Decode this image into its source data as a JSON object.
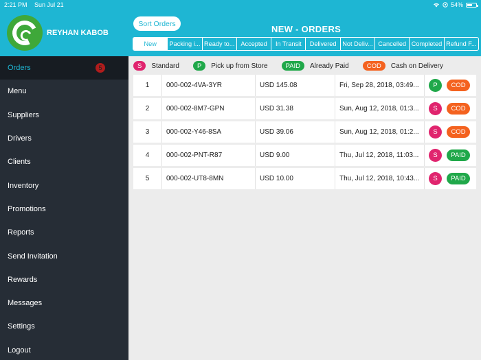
{
  "status_bar": {
    "time": "2:21 PM",
    "date": "Sun Jul 21",
    "battery": "54%"
  },
  "brand": {
    "name": "REYHAN KABOB"
  },
  "sidebar": {
    "items": [
      {
        "label": "Orders",
        "badge": "5"
      },
      {
        "label": "Menu"
      },
      {
        "label": "Suppliers"
      },
      {
        "label": "Drivers"
      },
      {
        "label": "Clients"
      },
      {
        "label": "Inventory"
      },
      {
        "label": "Promotions"
      },
      {
        "label": "Reports"
      },
      {
        "label": "Send Invitation"
      },
      {
        "label": "Rewards"
      },
      {
        "label": "Messages"
      },
      {
        "label": "Settings"
      },
      {
        "label": "Logout"
      }
    ]
  },
  "header": {
    "sort_label": "Sort Orders",
    "title": "NEW - ORDERS",
    "tabs": [
      "New",
      "Packing i...",
      "Ready to...",
      "Accepted",
      "In Transit",
      "Delivered",
      "Not Deliv...",
      "Cancelled",
      "Completed",
      "Refund F..."
    ]
  },
  "legend": {
    "standard_tag": "S",
    "standard_label": "Standard",
    "pickup_tag": "P",
    "pickup_label": "Pick up from Store",
    "paid_tag": "PAID",
    "paid_label": "Already Paid",
    "cod_tag": "COD",
    "cod_label": "Cash on Delivery"
  },
  "orders": [
    {
      "num": "1",
      "id": "000-002-4VA-3YR",
      "amount": "USD 145.08",
      "date": "Fri, Sep 28, 2018, 03:49...",
      "type": "P",
      "payment": "COD"
    },
    {
      "num": "2",
      "id": "000-002-8M7-GPN",
      "amount": "USD 31.38",
      "date": "Sun, Aug 12, 2018, 01:3...",
      "type": "S",
      "payment": "COD"
    },
    {
      "num": "3",
      "id": "000-002-Y46-8SA",
      "amount": "USD 39.06",
      "date": "Sun, Aug 12, 2018, 01:2...",
      "type": "S",
      "payment": "COD"
    },
    {
      "num": "4",
      "id": "000-002-PNT-R87",
      "amount": "USD 9.00",
      "date": "Thu, Jul 12, 2018, 11:03...",
      "type": "S",
      "payment": "PAID"
    },
    {
      "num": "5",
      "id": "000-002-UT8-8MN",
      "amount": "USD 10.00",
      "date": "Thu, Jul 12, 2018, 10:43...",
      "type": "S",
      "payment": "PAID"
    }
  ],
  "colors": {
    "accent": "#1eb6d3",
    "sidebar": "#262d36",
    "standard": "#e0246e",
    "paid": "#20a84a",
    "cod": "#f4621f"
  }
}
